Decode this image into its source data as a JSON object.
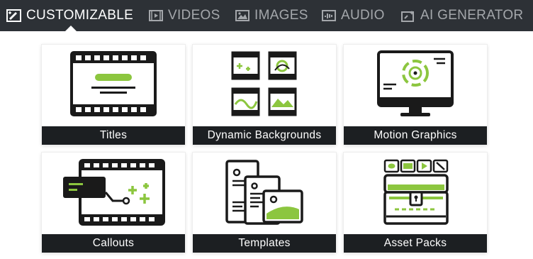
{
  "nav": {
    "tabs": [
      {
        "label": "CUSTOMIZABLE",
        "icon": "customizable-icon",
        "active": true
      },
      {
        "label": "VIDEOS",
        "icon": "video-icon",
        "active": false
      },
      {
        "label": "IMAGES",
        "icon": "image-icon",
        "active": false
      },
      {
        "label": "AUDIO",
        "icon": "audio-icon",
        "active": false
      },
      {
        "label": "AI GENERATOR",
        "icon": "ai-generator-icon",
        "active": false
      }
    ]
  },
  "cards": [
    {
      "label": "Titles",
      "icon": "titles-filmstrip-icon"
    },
    {
      "label": "Dynamic Backgrounds",
      "icon": "dynamic-backgrounds-icon"
    },
    {
      "label": "Motion Graphics",
      "icon": "motion-graphics-monitor-icon"
    },
    {
      "label": "Callouts",
      "icon": "callouts-icon"
    },
    {
      "label": "Templates",
      "icon": "templates-icon"
    },
    {
      "label": "Asset Packs",
      "icon": "asset-packs-chest-icon"
    }
  ],
  "colors": {
    "nav_background": "#2d3136",
    "active_tab": "#ffffff",
    "inactive_tab": "#a4a7ab",
    "accent": "#8cc63f",
    "card_label_background": "#1c1f22"
  }
}
